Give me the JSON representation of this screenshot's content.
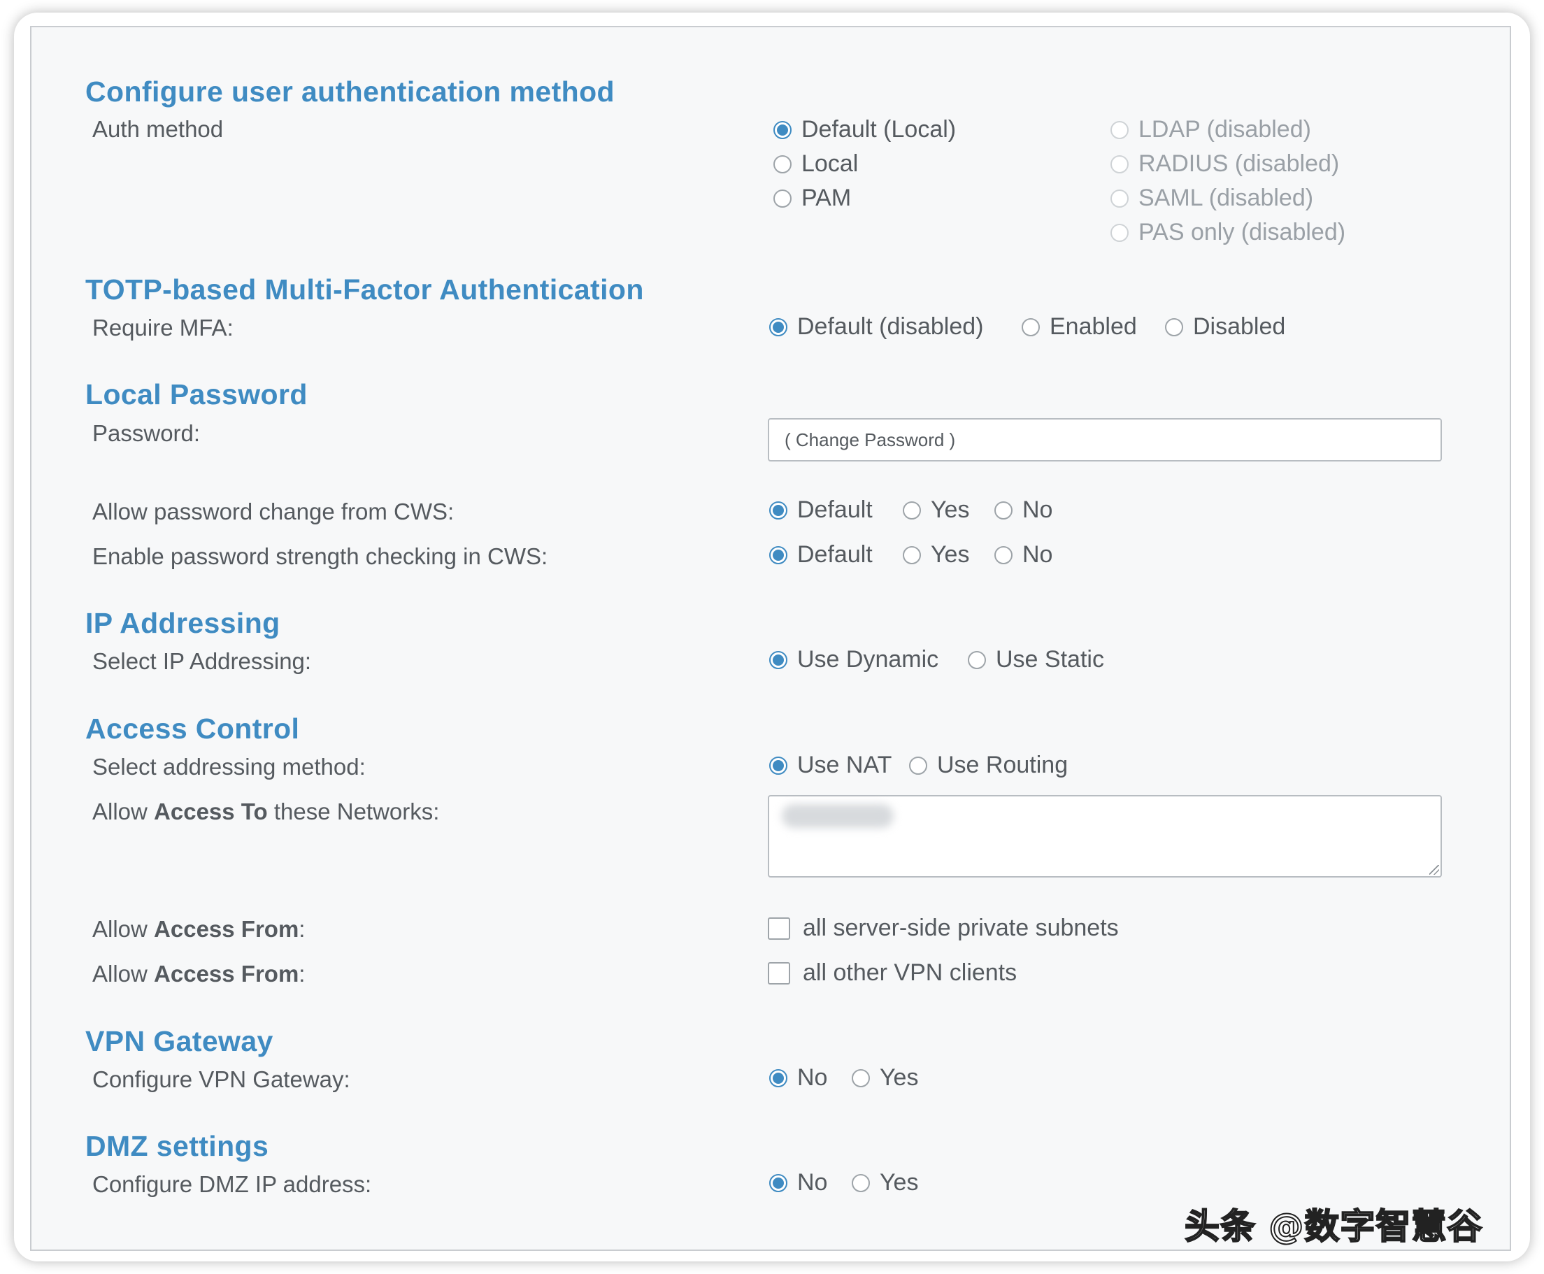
{
  "sections": {
    "auth": {
      "title": "Configure user authentication method",
      "label": "Auth method",
      "options": [
        {
          "label": "Default (Local)",
          "checked": true,
          "disabled": false
        },
        {
          "label": "Local",
          "checked": false,
          "disabled": false
        },
        {
          "label": "PAM",
          "checked": false,
          "disabled": false
        },
        {
          "label": "LDAP (disabled)",
          "checked": false,
          "disabled": true
        },
        {
          "label": "RADIUS (disabled)",
          "checked": false,
          "disabled": true
        },
        {
          "label": "SAML (disabled)",
          "checked": false,
          "disabled": true
        },
        {
          "label": "PAS only (disabled)",
          "checked": false,
          "disabled": true
        }
      ]
    },
    "mfa": {
      "title": "TOTP-based Multi-Factor Authentication",
      "label": "Require MFA:",
      "options": [
        "Default (disabled)",
        "Enabled",
        "Disabled"
      ],
      "selected": 0
    },
    "password": {
      "title": "Local Password",
      "label": "Password:",
      "placeholder": "( Change Password )",
      "change_cws": {
        "label": "Allow password change from CWS:",
        "options": [
          "Default",
          "Yes",
          "No"
        ],
        "selected": 0
      },
      "strength_cws": {
        "label": "Enable password strength checking in CWS:",
        "options": [
          "Default",
          "Yes",
          "No"
        ],
        "selected": 0
      }
    },
    "ip": {
      "title": "IP Addressing",
      "label": "Select IP Addressing:",
      "options": [
        "Use Dynamic",
        "Use Static"
      ],
      "selected": 0
    },
    "access": {
      "title": "Access Control",
      "method_label": "Select addressing method:",
      "method_options": [
        "Use NAT",
        "Use Routing"
      ],
      "selected": 0,
      "networks_label": {
        "pre": "Allow ",
        "bold": "Access To",
        "post": " these Networks:"
      },
      "from_label": {
        "pre": "Allow ",
        "bold": "Access From",
        "post": ":"
      },
      "from_private_subnets": "all server-side private subnets",
      "from_vpn_clients": "all other VPN clients"
    },
    "gateway": {
      "title": "VPN Gateway",
      "label": "Configure VPN Gateway:",
      "options": [
        "No",
        "Yes"
      ],
      "selected": 0
    },
    "dmz": {
      "title": "DMZ settings",
      "label": "Configure DMZ IP address:",
      "options": [
        "No",
        "Yes"
      ],
      "selected": 0
    }
  },
  "watermark": "头条 @数字智慧谷",
  "colors": {
    "accent": "#3f8bc2",
    "text": "#555a5f",
    "disabled_text": "#9aa0a6",
    "panel_bg": "#f7f8f9"
  }
}
